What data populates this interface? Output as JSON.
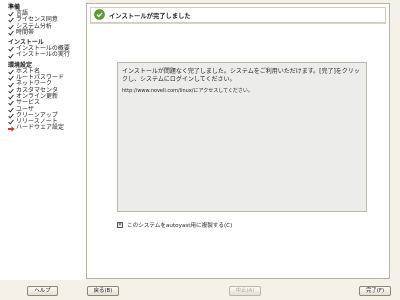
{
  "sidebar": {
    "sections": [
      {
        "title": "準備",
        "steps": [
          {
            "label": "言語",
            "state": "done"
          },
          {
            "label": "ライセンス同意",
            "state": "done"
          },
          {
            "label": "システム分析",
            "state": "done"
          },
          {
            "label": "時間帯",
            "state": "done"
          }
        ]
      },
      {
        "title": "インストール",
        "steps": [
          {
            "label": "インストールの概要",
            "state": "done"
          },
          {
            "label": "インストールの実行",
            "state": "done"
          }
        ]
      },
      {
        "title": "環境設定",
        "steps": [
          {
            "label": "ホスト名",
            "state": "done"
          },
          {
            "label": "ルートパスワード",
            "state": "done"
          },
          {
            "label": "ネットワーク",
            "state": "done"
          },
          {
            "label": "カスタマセンタ",
            "state": "done"
          },
          {
            "label": "オンライン更新",
            "state": "done"
          },
          {
            "label": "サービス",
            "state": "done"
          },
          {
            "label": "ユーザ",
            "state": "done"
          },
          {
            "label": "クリーンアップ",
            "state": "done"
          },
          {
            "label": "リリースノート",
            "state": "done"
          },
          {
            "label": "ハードウェア設定",
            "state": "current"
          }
        ]
      }
    ]
  },
  "header": {
    "title": "インストールが完了しました",
    "icon": "checkmark-circle-icon"
  },
  "message": {
    "line1": "インストールが問題なく完了しました。システムをご利用いただけます。[完了]をクリッ",
    "line2": "クし、システムにログインしてください。",
    "url_line": "http://www.novell.com/linux/にアクセスしてください。"
  },
  "option": {
    "checked": true,
    "label": "このシステムをautoyast用に複製する(C)"
  },
  "buttons": {
    "help": "ヘルプ",
    "back": "戻る(B)",
    "abort": "中止(A)",
    "finish": "完了(F)"
  },
  "colors": {
    "done_check": "#2b2b2b",
    "current_arrow": "#d43a2a",
    "header_icon": "#5aa02c"
  }
}
